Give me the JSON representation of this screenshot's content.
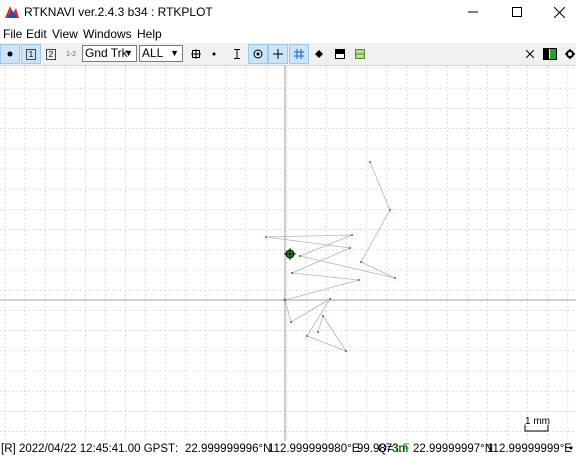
{
  "window": {
    "title": "RTKNAVI ver.2.4.3 b34 : RTKPLOT",
    "minimize_icon": "minimize-icon",
    "maximize_icon": "maximize-icon",
    "close_icon": "close-icon"
  },
  "menu": [
    {
      "label": "File"
    },
    {
      "label": "Edit"
    },
    {
      "label": "View"
    },
    {
      "label": "Windows"
    },
    {
      "label": "Help"
    }
  ],
  "toolbar": {
    "rover1": "1",
    "rover2": "2",
    "rover12": "1-2",
    "plot_type": "Gnd Trk",
    "quality": "ALL"
  },
  "plot": {
    "scale_label": "1 mm",
    "colors": {
      "grid": "#c8c8c8",
      "axis": "#a0a0a0",
      "track": "#b4b4b4",
      "point": "#00a000",
      "marker": "#1a8c1a"
    }
  },
  "status": {
    "mode": "[R]",
    "time": "2022/04/22 12:45:41.00 GPST",
    "lat": "22.999999996°N",
    "lon": "112.999999980°E",
    "height": "99.9873m",
    "q_label": "Q=",
    "q_value": "1:F",
    "lat2": "22.99999997°N",
    "lon2": "112.99999999°E",
    "bullet": "•"
  }
}
